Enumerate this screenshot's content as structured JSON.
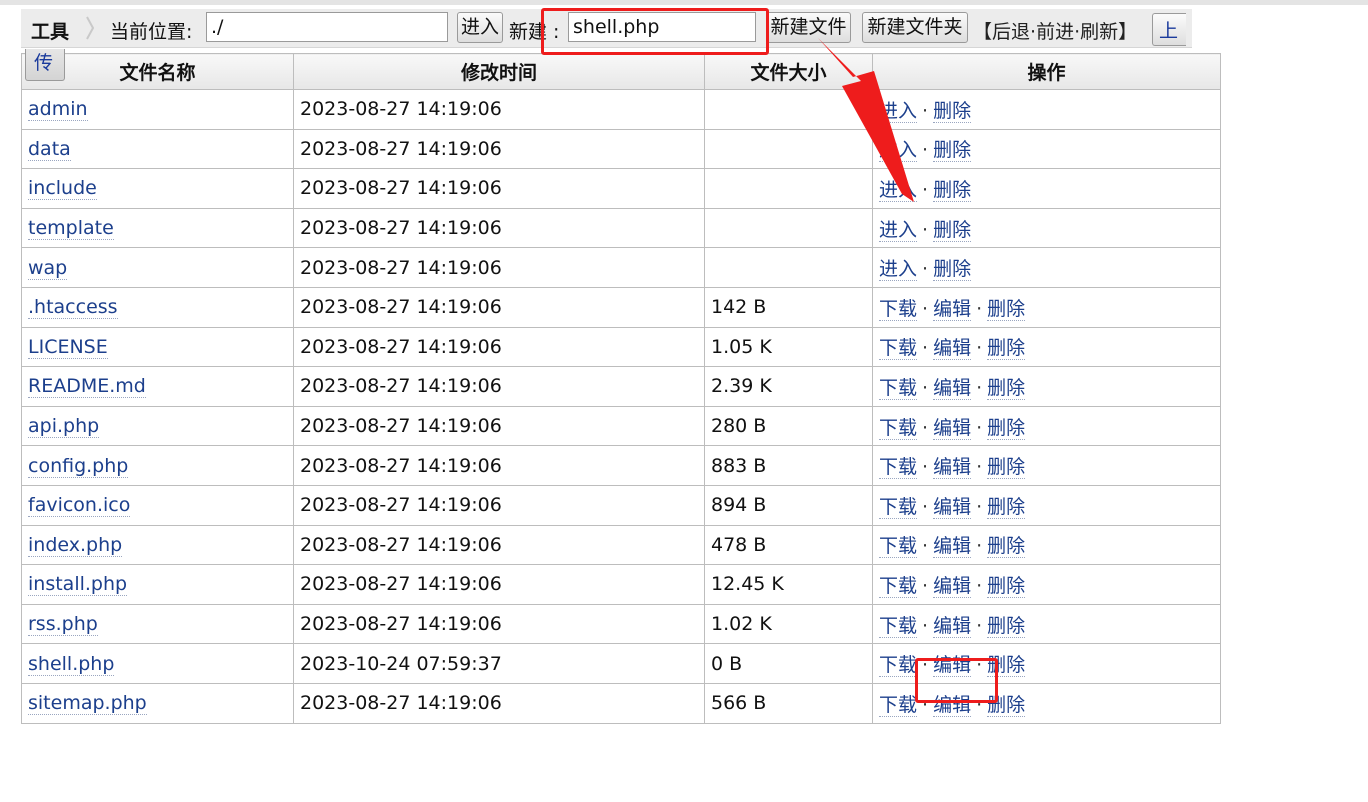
{
  "toolbar": {
    "title": "工具",
    "location_label": "当前位置:",
    "location_value": "./",
    "enter_button": "进入",
    "new_label": "新建 :",
    "new_value": "shell.php",
    "new_file_button": "新建文件",
    "new_folder_button": "新建文件夹",
    "nav_open": "【",
    "back": "后退",
    "forward": "前进",
    "refresh": "刷新",
    "nav_close": "】",
    "sep": "·",
    "upload_top": "上",
    "upload_bottom": "传"
  },
  "table": {
    "headers": [
      "文件名称",
      "修改时间",
      "文件大小",
      "操作"
    ],
    "actions": {
      "enter": "进入",
      "delete": "删除",
      "download": "下载",
      "edit": "编辑",
      "sep": "·"
    },
    "rows": [
      {
        "name": "admin",
        "time": "2023-08-27 14:19:06",
        "size": "",
        "type": "dir"
      },
      {
        "name": "data",
        "time": "2023-08-27 14:19:06",
        "size": "",
        "type": "dir"
      },
      {
        "name": "include",
        "time": "2023-08-27 14:19:06",
        "size": "",
        "type": "dir"
      },
      {
        "name": "template",
        "time": "2023-08-27 14:19:06",
        "size": "",
        "type": "dir"
      },
      {
        "name": "wap",
        "time": "2023-08-27 14:19:06",
        "size": "",
        "type": "dir"
      },
      {
        "name": ".htaccess",
        "time": "2023-08-27 14:19:06",
        "size": "142 B",
        "type": "file"
      },
      {
        "name": "LICENSE",
        "time": "2023-08-27 14:19:06",
        "size": "1.05 K",
        "type": "file"
      },
      {
        "name": "README.md",
        "time": "2023-08-27 14:19:06",
        "size": "2.39 K",
        "type": "file"
      },
      {
        "name": "api.php",
        "time": "2023-08-27 14:19:06",
        "size": "280 B",
        "type": "file"
      },
      {
        "name": "config.php",
        "time": "2023-08-27 14:19:06",
        "size": "883 B",
        "type": "file"
      },
      {
        "name": "favicon.ico",
        "time": "2023-08-27 14:19:06",
        "size": "894 B",
        "type": "file"
      },
      {
        "name": "index.php",
        "time": "2023-08-27 14:19:06",
        "size": "478 B",
        "type": "file"
      },
      {
        "name": "install.php",
        "time": "2023-08-27 14:19:06",
        "size": "12.45 K",
        "type": "file"
      },
      {
        "name": "rss.php",
        "time": "2023-08-27 14:19:06",
        "size": "1.02 K",
        "type": "file"
      },
      {
        "name": "shell.php",
        "time": "2023-10-24 07:59:37",
        "size": "0 B",
        "type": "file"
      },
      {
        "name": "sitemap.php",
        "time": "2023-08-27 14:19:06",
        "size": "566 B",
        "type": "file"
      }
    ]
  },
  "annotation_color": "#ee1c1c"
}
